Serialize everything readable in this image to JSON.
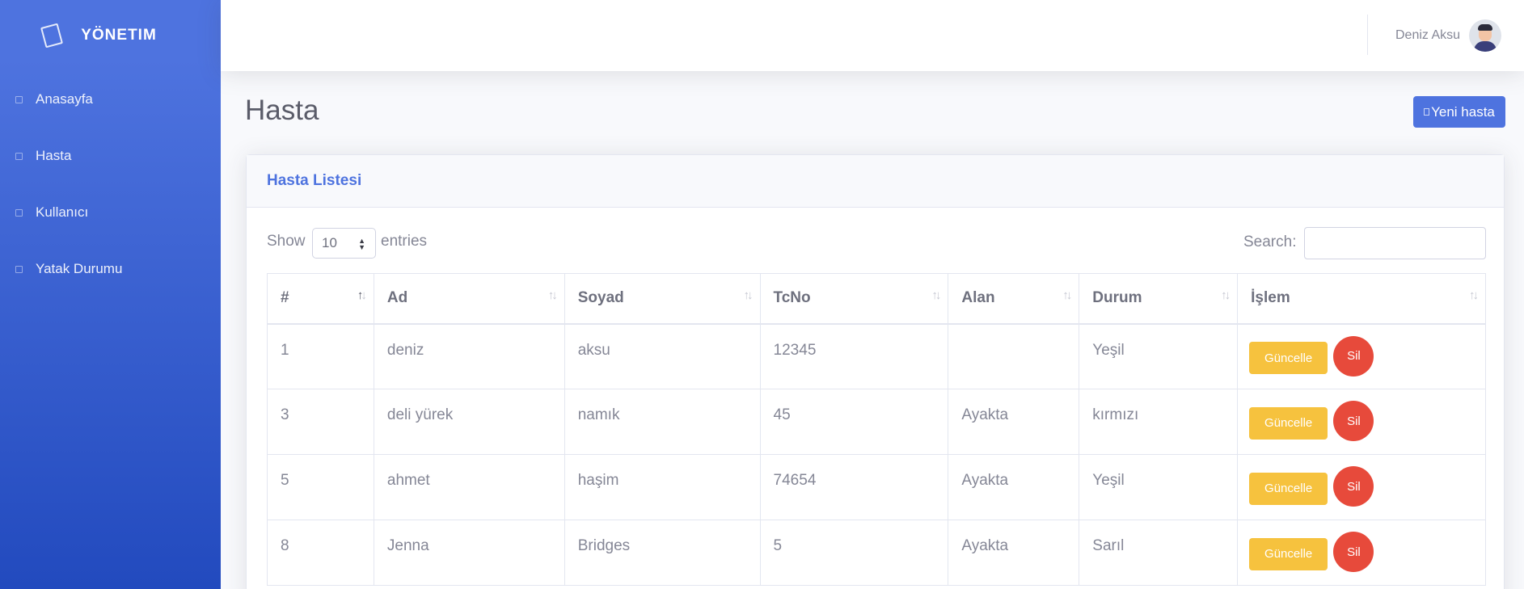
{
  "sidebar": {
    "brand": "YÖNETIM",
    "items": [
      {
        "label": "Anasayfa"
      },
      {
        "label": "Hasta"
      },
      {
        "label": "Kullanıcı"
      },
      {
        "label": "Yatak Durumu"
      }
    ]
  },
  "topbar": {
    "user_name": "Deniz Aksu"
  },
  "page": {
    "title": "Hasta",
    "new_button": "Yeni hasta"
  },
  "card": {
    "title": "Hasta Listesi",
    "show_label": "Show",
    "entries_value": "10",
    "entries_label": "entries",
    "search_label": "Search:",
    "search_value": ""
  },
  "table": {
    "columns": [
      "#",
      "Ad",
      "Soyad",
      "TcNo",
      "Alan",
      "Durum",
      "İşlem"
    ],
    "rows": [
      [
        "1",
        "deniz",
        "aksu",
        "12345",
        "",
        "Yeşil"
      ],
      [
        "3",
        "deli yürek",
        "namık",
        "45",
        "Ayakta",
        "kırmızı"
      ],
      [
        "5",
        "ahmet",
        "haşim",
        "74654",
        "Ayakta",
        "Yeşil"
      ],
      [
        "8",
        "Jenna",
        "Bridges",
        "5",
        "Ayakta",
        "Sarıl"
      ]
    ],
    "update_label": "Güncelle",
    "delete_label": "Sil"
  },
  "colors": {
    "primary": "#4e73df",
    "warning": "#f6c23e",
    "danger": "#e74a3b"
  }
}
